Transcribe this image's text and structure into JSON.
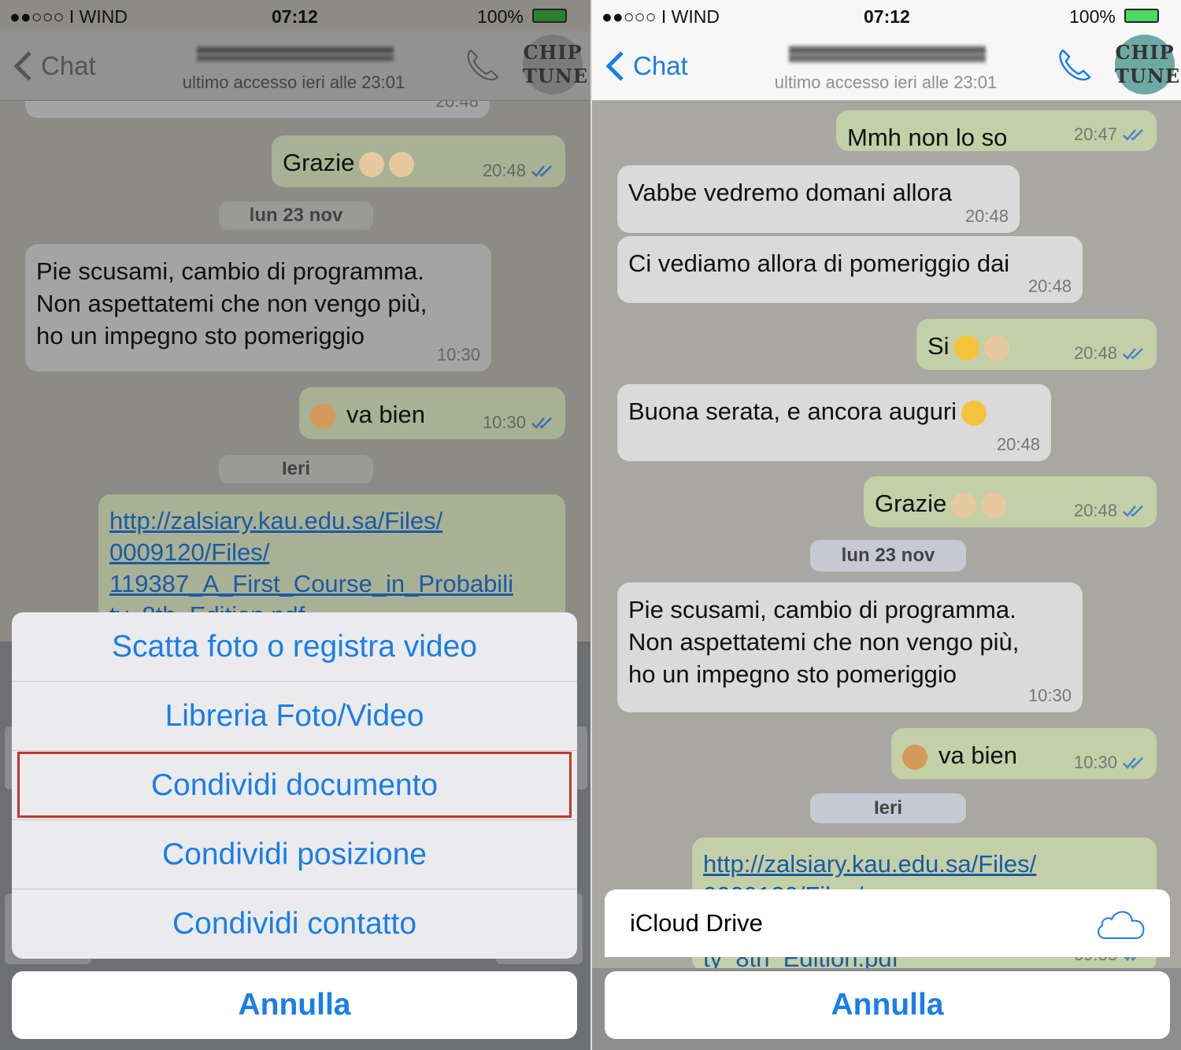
{
  "status_bar": {
    "carrier": "●●○○○ I WIND",
    "time": "07:12",
    "battery": "100%",
    "battery_color": "#3ec33e"
  },
  "header": {
    "back_label": "Chat",
    "last_seen": "ultimo accesso ieri alle 23:01",
    "avatar_text": [
      "CHIP",
      "TUNE"
    ],
    "accent": "#1a7ee8"
  },
  "left": {
    "messages": [
      {
        "type": "in",
        "text": "",
        "time": "20:48"
      },
      {
        "type": "out",
        "text": "Grazie",
        "emoji": [
          "waving-hand",
          "waving-hand"
        ],
        "time": "20:48"
      },
      {
        "type": "date",
        "text": "lun 23 nov"
      },
      {
        "type": "in",
        "text": "Pie scusami, cambio di programma.\nNon aspettatemi che non vengo più,\nho un impegno sto pomeriggio",
        "time": "10:30"
      },
      {
        "type": "out",
        "text": "va bien",
        "emoji_before": [
          "thumbs-down"
        ],
        "time": "10:30"
      },
      {
        "type": "date",
        "text": "Ieri"
      },
      {
        "type": "link",
        "text": "http://zalsiary.kau.edu.sa/Files/\n0009120/Files/\n119387_A_First_Course_in_Probabili\nty_8th_Edition.pdf",
        "time": ""
      }
    ],
    "action_sheet": {
      "options": [
        "Scatta foto o registra video",
        "Libreria Foto/Video",
        "Condividi documento",
        "Condividi posizione",
        "Condividi contatto"
      ],
      "highlighted": "Condividi documento",
      "cancel": "Annulla"
    }
  },
  "right": {
    "messages": [
      {
        "type": "out",
        "text": "Mmh non lo so",
        "time": "20:47"
      },
      {
        "type": "in",
        "text": "Vabbe vedremo domani allora",
        "time": "20:48"
      },
      {
        "type": "in",
        "text": "Ci vediamo allora di pomeriggio dai",
        "time": "20:48"
      },
      {
        "type": "out",
        "text": "Si",
        "emoji": [
          "kissing-face",
          "waving-hand"
        ],
        "time": "20:48"
      },
      {
        "type": "in",
        "text": "Buona serata, e ancora auguri",
        "emoji": [
          "smiling-face"
        ],
        "time": "20:48"
      },
      {
        "type": "out",
        "text": "Grazie",
        "emoji": [
          "waving-hand",
          "waving-hand"
        ],
        "time": "20:48"
      },
      {
        "type": "date",
        "text": "lun 23 nov"
      },
      {
        "type": "in",
        "text": "Pie scusami, cambio di programma.\nNon aspettatemi che non vengo più,\nho un impegno sto pomeriggio",
        "time": "10:30"
      },
      {
        "type": "out",
        "text": "va bien",
        "emoji_before": [
          "thumbs-down"
        ],
        "time": "10:30"
      },
      {
        "type": "date",
        "text": "Ieri"
      },
      {
        "type": "link",
        "text": "http://zalsiary.kau.edu.sa/Files/\n0009120/Files/\n\nty_8th_Edition.pdf",
        "time": "09:33"
      }
    ],
    "document_picker": {
      "provider": "iCloud Drive",
      "icon": "cloud-icon",
      "cancel": "Annulla"
    }
  }
}
